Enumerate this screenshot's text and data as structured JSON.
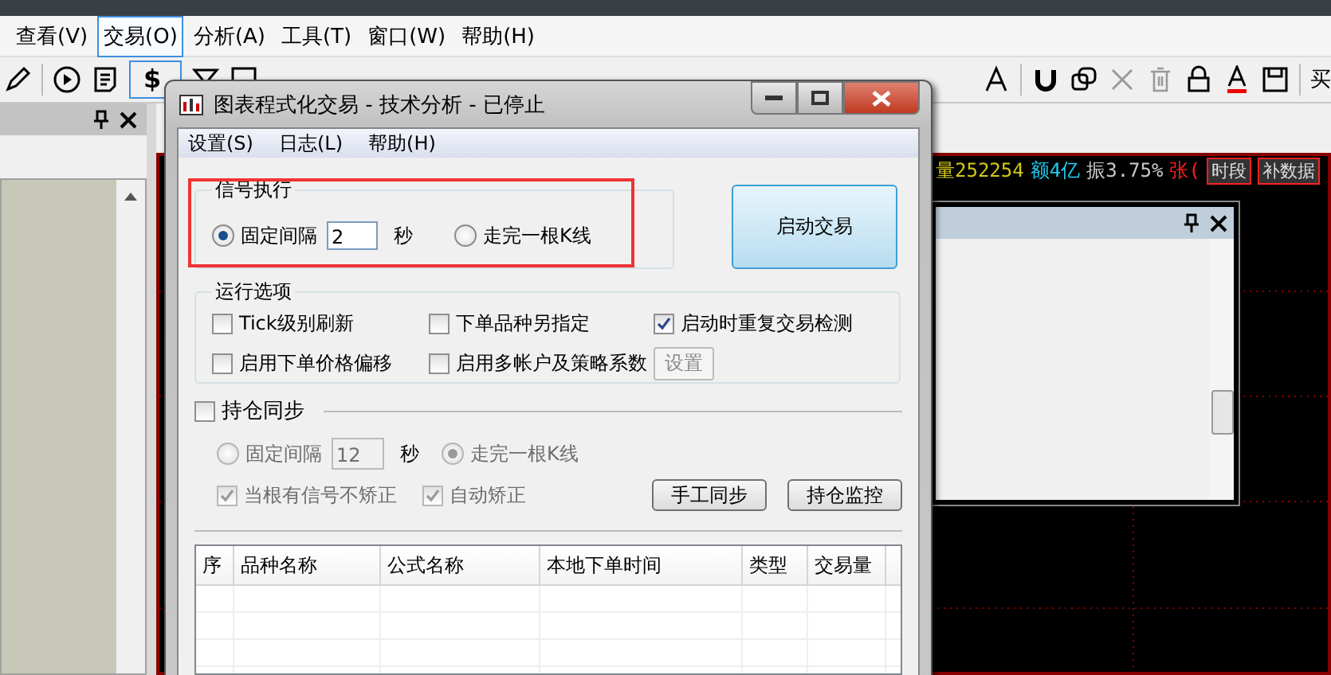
{
  "app_menu": [
    {
      "label": "查看(V)",
      "selected": false
    },
    {
      "label": "交易(O)",
      "selected": true
    },
    {
      "label": "分析(A)",
      "selected": false
    },
    {
      "label": "工具(T)",
      "selected": false
    },
    {
      "label": "窗口(W)",
      "selected": false
    },
    {
      "label": "帮助(H)",
      "selected": false
    }
  ],
  "toolbar": {
    "currency_button": "$",
    "buy_label": "买"
  },
  "quote_bar": [
    {
      "text": "量252254",
      "color": "#d2c814"
    },
    {
      "text": "额4亿",
      "color": "#1ecdf0"
    },
    {
      "text": "振3.75%",
      "color": "#c8c8c8"
    },
    {
      "text": "张(",
      "color": "#ff2020"
    }
  ],
  "quote_buttons": [
    "时段",
    "补数据"
  ],
  "dialog": {
    "title": "图表程式化交易 - 技术分析 - 已停止",
    "menu": [
      "设置(S)",
      "日志(L)",
      "帮助(H)"
    ],
    "signal_group": {
      "title": "信号执行",
      "options": [
        {
          "label": "固定间隔",
          "selected": true
        },
        {
          "label": "走完一根K线",
          "selected": false
        }
      ],
      "interval_value": "2",
      "unit": "秒",
      "highlighted": true
    },
    "start_button": "启动交易",
    "run_options": {
      "title": "运行选项",
      "items": [
        {
          "label": "Tick级别刷新",
          "checked": false
        },
        {
          "label": "下单品种另指定",
          "checked": false
        },
        {
          "label": "启动时重复交易检测",
          "checked": true
        },
        {
          "label": "启用下单价格偏移",
          "checked": false
        },
        {
          "label": "启用多帐户及策略系数",
          "checked": false
        }
      ],
      "settings_button": {
        "label": "设置",
        "disabled": true
      }
    },
    "position_sync": {
      "label": "持仓同步",
      "checked": false,
      "options": [
        {
          "label": "固定间隔",
          "selected": false
        },
        {
          "label": "走完一根K线",
          "selected": true
        }
      ],
      "interval_value": "12",
      "unit": "秒",
      "checks": [
        {
          "label": "当根有信号不矫正",
          "checked": true
        },
        {
          "label": "自动矫正",
          "checked": true
        }
      ],
      "buttons": [
        "手工同步",
        "持仓监控"
      ]
    },
    "table": {
      "columns": [
        "序",
        "品种名称",
        "公式名称",
        "本地下单时间",
        "类型",
        "交易量"
      ]
    }
  }
}
